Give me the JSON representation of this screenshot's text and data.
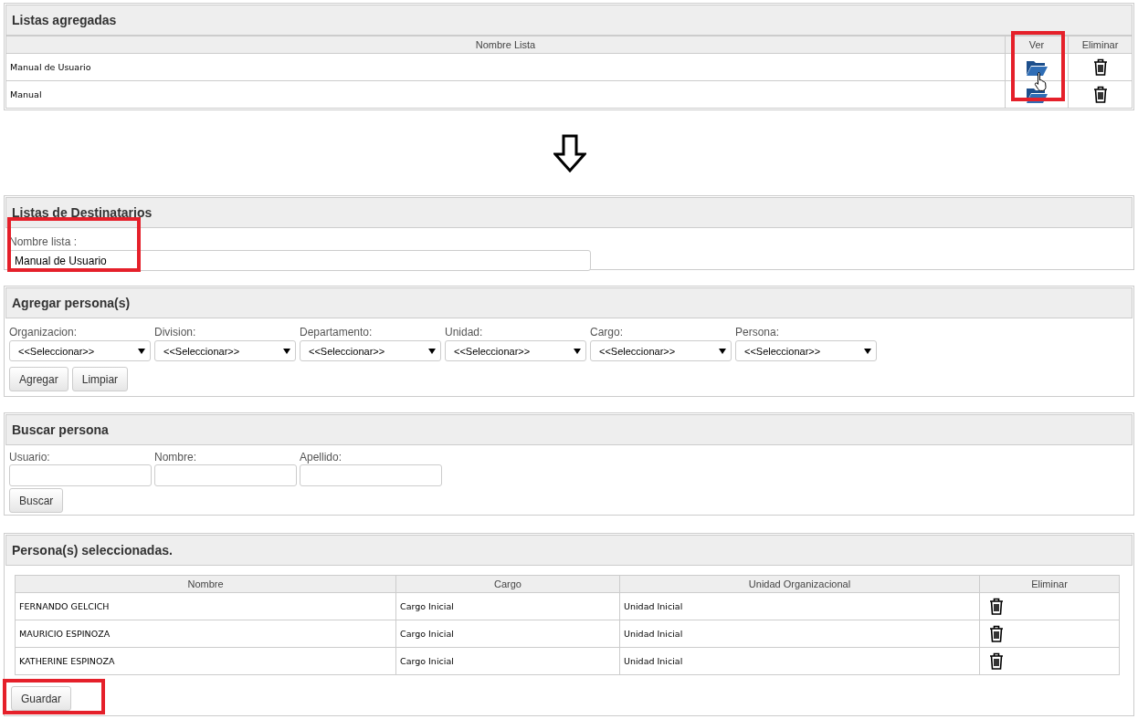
{
  "listas_agregadas": {
    "title": "Listas agregadas",
    "columns": [
      "Nombre Lista",
      "Ver",
      "Eliminar"
    ],
    "rows": [
      {
        "name": "Manual de Usuario"
      },
      {
        "name": "Manual"
      }
    ]
  },
  "destinatarios": {
    "title": "Listas de Destinatarios",
    "label": "Nombre lista :",
    "value": "Manual de Usuario"
  },
  "agregar": {
    "title": "Agregar persona(s)",
    "selects": [
      {
        "label": "Organizacion:",
        "value": "<<Seleccionar>>"
      },
      {
        "label": "Division:",
        "value": "<<Seleccionar>>"
      },
      {
        "label": "Departamento:",
        "value": "<<Seleccionar>>"
      },
      {
        "label": "Unidad:",
        "value": "<<Seleccionar>>"
      },
      {
        "label": "Cargo:",
        "value": "<<Seleccionar>>"
      },
      {
        "label": "Persona:",
        "value": "<<Seleccionar>>"
      }
    ],
    "buttons": [
      "Agregar",
      "Limpiar"
    ]
  },
  "buscar": {
    "title": "Buscar persona",
    "fields": [
      {
        "label": "Usuario:"
      },
      {
        "label": "Nombre:"
      },
      {
        "label": "Apellido:"
      }
    ],
    "button": "Buscar"
  },
  "seleccionadas": {
    "title": "Persona(s) seleccionadas.",
    "columns": [
      "Nombre",
      "Cargo",
      "Unidad Organizacional",
      "Eliminar"
    ],
    "rows": [
      {
        "nombre": "FERNANDO GELCICH",
        "cargo": "Cargo Inicial",
        "unidad": "Unidad Inicial"
      },
      {
        "nombre": "MAURICIO ESPINOZA",
        "cargo": "Cargo Inicial",
        "unidad": "Unidad Inicial"
      },
      {
        "nombre": "KATHERINE ESPINOZA",
        "cargo": "Cargo Inicial",
        "unidad": "Unidad Inicial"
      }
    ],
    "button": "Guardar"
  }
}
